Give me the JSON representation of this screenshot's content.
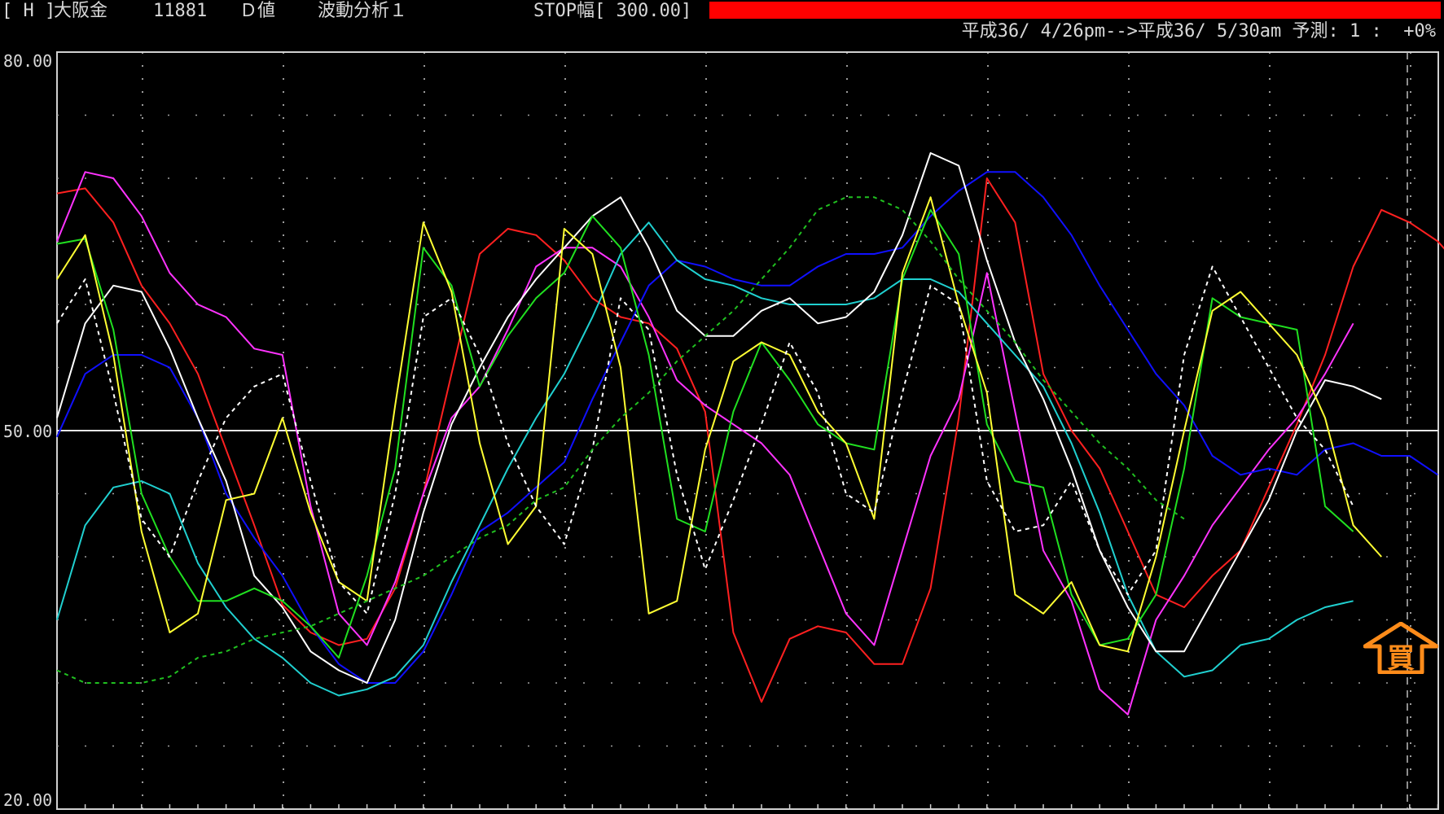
{
  "header": {
    "symbol_code": "[ H ]",
    "instrument": "大阪金",
    "price": "11881",
    "value_type": "Ｄ値",
    "analysis": "波動分析１",
    "stop_width": "STOP幅[ 300.00]",
    "period": "平成36/ 4/26pm-->平成36/ 5/30am",
    "forecast": "予測: 1 :  +0%"
  },
  "colors": {
    "background": "#000000",
    "stop_bar": "#ff0000",
    "signal": "#ff8c1a",
    "grid": "#ffffff"
  },
  "signal": {
    "icon": "buy-arrow-icon",
    "label": "買"
  },
  "chart_data": {
    "type": "line",
    "ylim": [
      20,
      80
    ],
    "y_ticks": [
      "80.00",
      "50.00",
      "20.00"
    ],
    "mid_line": 50,
    "grid": true,
    "x": [
      0,
      1,
      2,
      3,
      4,
      5,
      6,
      7,
      8,
      9,
      10,
      11,
      12,
      13,
      14,
      15,
      16,
      17,
      18,
      19,
      20,
      21,
      22,
      23,
      24,
      25,
      26,
      27,
      28,
      29,
      30,
      31,
      32,
      33,
      34,
      35,
      36,
      37,
      38,
      39,
      40,
      41,
      42,
      43,
      44,
      45,
      46,
      47,
      48,
      49,
      50
    ],
    "series": [
      {
        "color": "#ff2020",
        "style": "solid",
        "values": [
          68.8,
          69.2,
          66.5,
          61.5,
          58.5,
          54.5,
          48.5,
          42.5,
          36.2,
          34.0,
          33.0,
          33.5,
          37.5,
          45.0,
          54.5,
          64.0,
          66.0,
          65.5,
          63.5,
          60.5,
          59.0,
          58.5,
          56.5,
          51.5,
          34.0,
          28.5,
          33.5,
          34.5,
          34.0,
          31.5,
          31.5,
          37.5,
          51.0,
          70.0,
          66.5,
          54.5,
          50.0,
          47.0,
          42.0,
          37.0,
          36.0,
          38.5,
          40.5,
          45.5,
          50.5,
          56.0,
          63.0,
          67.5,
          66.5,
          65.0,
          62.5
        ]
      },
      {
        "color": "#ff33ff",
        "style": "solid",
        "values": [
          65.0,
          70.5,
          70.0,
          67.0,
          62.5,
          60.0,
          59.0,
          56.5,
          56.0,
          44.0,
          35.5,
          33.0,
          38.0,
          45.0,
          51.0,
          53.5,
          58.0,
          63.0,
          64.5,
          64.5,
          63.0,
          59.0,
          54.0,
          52.0,
          50.5,
          49.0,
          46.5,
          41.0,
          35.5,
          33.0,
          40.5,
          48.0,
          52.5,
          62.5,
          51.5,
          40.5,
          36.5,
          29.5,
          27.5,
          35.0,
          38.5,
          42.5,
          45.5,
          48.5,
          51.0,
          54.5,
          58.5
        ]
      },
      {
        "color": "#1010ff",
        "style": "solid",
        "values": [
          49.5,
          54.5,
          56.0,
          56.0,
          55.0,
          51.0,
          45.0,
          41.5,
          38.5,
          34.5,
          31.5,
          30.0,
          30.0,
          32.5,
          37.0,
          42.0,
          43.5,
          45.5,
          47.5,
          52.5,
          57.0,
          61.5,
          63.5,
          63.0,
          62.0,
          61.5,
          61.5,
          63.0,
          64.0,
          64.0,
          64.5,
          67.0,
          69.0,
          70.5,
          70.5,
          68.5,
          65.5,
          61.5,
          58.0,
          54.5,
          52.0,
          48.0,
          46.5,
          47.0,
          46.5,
          48.5,
          49.0,
          48.0,
          48.0,
          46.5
        ]
      },
      {
        "color": "#20d0d0",
        "style": "solid",
        "values": [
          35.0,
          42.5,
          45.5,
          46.0,
          45.0,
          39.5,
          36.0,
          33.5,
          32.0,
          30.0,
          29.0,
          29.5,
          30.5,
          33.0,
          38.0,
          42.5,
          47.0,
          51.0,
          54.5,
          59.0,
          64.0,
          66.5,
          63.5,
          62.0,
          61.5,
          60.5,
          60.0,
          60.0,
          60.0,
          60.5,
          62.0,
          62.0,
          61.0,
          58.5,
          56.0,
          53.5,
          49.0,
          43.5,
          37.0,
          32.5,
          30.5,
          31.0,
          33.0,
          33.5,
          35.0,
          36.0,
          36.5
        ]
      },
      {
        "color": "#ffffff",
        "style": "solid",
        "values": [
          51.0,
          58.5,
          61.5,
          61.0,
          56.5,
          51.0,
          46.0,
          38.5,
          36.0,
          32.5,
          31.0,
          30.0,
          35.0,
          43.5,
          50.5,
          55.0,
          59.0,
          62.0,
          64.5,
          67.0,
          68.5,
          64.5,
          59.5,
          57.5,
          57.5,
          59.5,
          60.5,
          58.5,
          59.0,
          61.0,
          65.5,
          72.0,
          71.0,
          63.5,
          57.0,
          52.5,
          47.0,
          40.5,
          36.0,
          32.5,
          32.5,
          36.5,
          40.5,
          44.5,
          50.0,
          54.0,
          53.5,
          52.5
        ]
      },
      {
        "color": "#20e020",
        "style": "solid",
        "values": [
          64.8,
          65.2,
          58.0,
          45.0,
          40.0,
          36.5,
          36.5,
          37.5,
          36.5,
          34.5,
          32.0,
          38.5,
          47.0,
          64.5,
          61.5,
          53.5,
          57.5,
          60.5,
          62.5,
          67.0,
          64.5,
          56.0,
          43.0,
          42.0,
          51.5,
          57.0,
          54.0,
          50.5,
          49.0,
          48.5,
          62.0,
          67.5,
          64.0,
          50.5,
          46.0,
          45.5,
          37.0,
          33.0,
          33.5,
          37.0,
          47.0,
          60.5,
          59.0,
          58.5,
          58.0,
          44.0,
          42.0
        ]
      },
      {
        "color": "#ffff33",
        "style": "solid",
        "values": [
          62.0,
          65.5,
          56.0,
          42.0,
          34.0,
          35.5,
          44.5,
          45.0,
          51.0,
          43.5,
          38.0,
          36.5,
          52.0,
          66.5,
          61.0,
          49.0,
          41.0,
          44.0,
          66.0,
          64.0,
          55.0,
          35.5,
          36.5,
          48.5,
          55.5,
          57.0,
          56.0,
          51.5,
          49.0,
          43.0,
          62.5,
          68.5,
          60.0,
          53.0,
          37.0,
          35.5,
          38.0,
          33.0,
          32.5,
          40.0,
          50.0,
          59.5,
          61.0,
          58.5,
          56.0,
          51.0,
          42.5,
          40.0
        ]
      },
      {
        "color": "#ffffff",
        "style": "dashed",
        "values": [
          58.5,
          62.0,
          53.0,
          43.0,
          40.0,
          46.0,
          51.0,
          53.5,
          54.5,
          46.0,
          38.0,
          35.5,
          45.0,
          59.0,
          60.5,
          56.0,
          49.0,
          44.0,
          41.0,
          48.5,
          60.5,
          58.0,
          46.5,
          39.0,
          44.5,
          50.5,
          57.0,
          53.0,
          45.0,
          43.5,
          53.0,
          61.5,
          60.0,
          46.0,
          42.0,
          42.5,
          46.0,
          40.5,
          37.0,
          40.5,
          56.0,
          63.0,
          59.0,
          55.0,
          51.0,
          48.5,
          44.0
        ]
      },
      {
        "color": "#20c020",
        "style": "dashed",
        "values": [
          31.0,
          30.0,
          30.0,
          30.0,
          30.5,
          32.0,
          32.5,
          33.5,
          34.0,
          34.5,
          35.5,
          36.5,
          37.5,
          38.5,
          40.0,
          41.5,
          42.5,
          44.5,
          45.5,
          48.5,
          51.0,
          53.0,
          55.5,
          57.5,
          59.5,
          62.0,
          64.5,
          67.5,
          68.5,
          68.5,
          67.5,
          65.0,
          62.0,
          59.5,
          57.0,
          54.0,
          51.5,
          49.0,
          47.0,
          44.5,
          43.0
        ]
      }
    ]
  }
}
